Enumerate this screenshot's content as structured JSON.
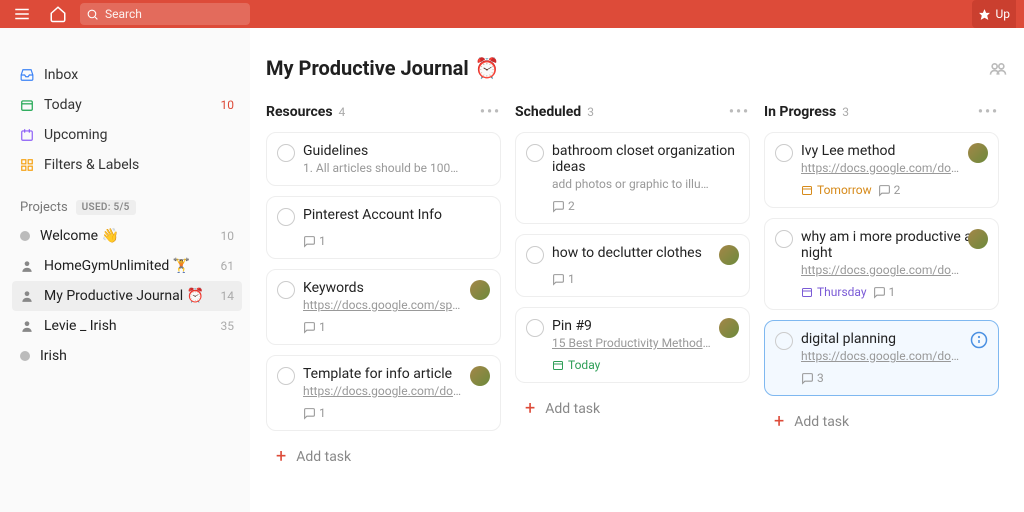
{
  "topbar": {
    "search_placeholder": "Search",
    "upgrade_label": "Up"
  },
  "sidebar": {
    "items": [
      {
        "label": "Inbox",
        "count": ""
      },
      {
        "label": "Today",
        "count": "10"
      },
      {
        "label": "Upcoming",
        "count": ""
      },
      {
        "label": "Filters & Labels",
        "count": ""
      }
    ],
    "projects_header": "Projects",
    "used_badge": "USED: 5/5",
    "projects": [
      {
        "label": "Welcome 👋",
        "count": "10"
      },
      {
        "label": "HomeGymUnlimited 🏋",
        "count": "61"
      },
      {
        "label": "My Productive Journal ⏰",
        "count": "14"
      },
      {
        "label": "Levie _ Irish",
        "count": "35"
      },
      {
        "label": "Irish",
        "count": ""
      }
    ]
  },
  "page": {
    "title": "My Productive Journal",
    "title_icon": "⏰"
  },
  "columns": [
    {
      "name": "Resources",
      "count": "4",
      "add_label": "Add task",
      "cards": [
        {
          "title": "Guidelines",
          "subtitle": "1. All articles should be 1000+ w…",
          "link": false,
          "comments": "",
          "avatar": false
        },
        {
          "title": "Pinterest Account Info",
          "subtitle": "",
          "link": false,
          "comments": "1",
          "avatar": false
        },
        {
          "title": "Keywords",
          "subtitle": "https://docs.google.com/spread…",
          "link": true,
          "comments": "1",
          "avatar": true
        },
        {
          "title": "Template for info article",
          "subtitle": "https://docs.google.com/docum…",
          "link": true,
          "comments": "1",
          "avatar": true
        }
      ]
    },
    {
      "name": "Scheduled",
      "count": "3",
      "add_label": "Add task",
      "cards": [
        {
          "title": "bathroom closet organization ideas",
          "subtitle": "add photos or graphic to illustra…",
          "link": false,
          "comments": "2",
          "avatar": false
        },
        {
          "title": "how to declutter clothes",
          "subtitle": "",
          "link": false,
          "comments": "1",
          "avatar": true
        },
        {
          "title": "Pin #9",
          "subtitle": "15 Best Productivity Methods Yo…",
          "link": true,
          "comments": "",
          "avatar": true,
          "due": "Today",
          "due_tone": "green"
        }
      ]
    },
    {
      "name": "In Progress",
      "count": "3",
      "add_label": "Add task",
      "cards": [
        {
          "title": "Ivy Lee method",
          "subtitle": "https://docs.google.com/docum…",
          "link": true,
          "comments": "2",
          "avatar": true,
          "due": "Tomorrow",
          "due_tone": "orange"
        },
        {
          "title": "why am i more productive at night",
          "subtitle": "https://docs.google.com/docum…",
          "link": true,
          "comments": "1",
          "avatar": true,
          "due": "Thursday",
          "due_tone": "purple"
        },
        {
          "title": "digital planning",
          "subtitle": "https://docs.google.com/docum…",
          "link": true,
          "comments": "3",
          "avatar": false,
          "info": true,
          "highlight": true
        }
      ]
    }
  ]
}
